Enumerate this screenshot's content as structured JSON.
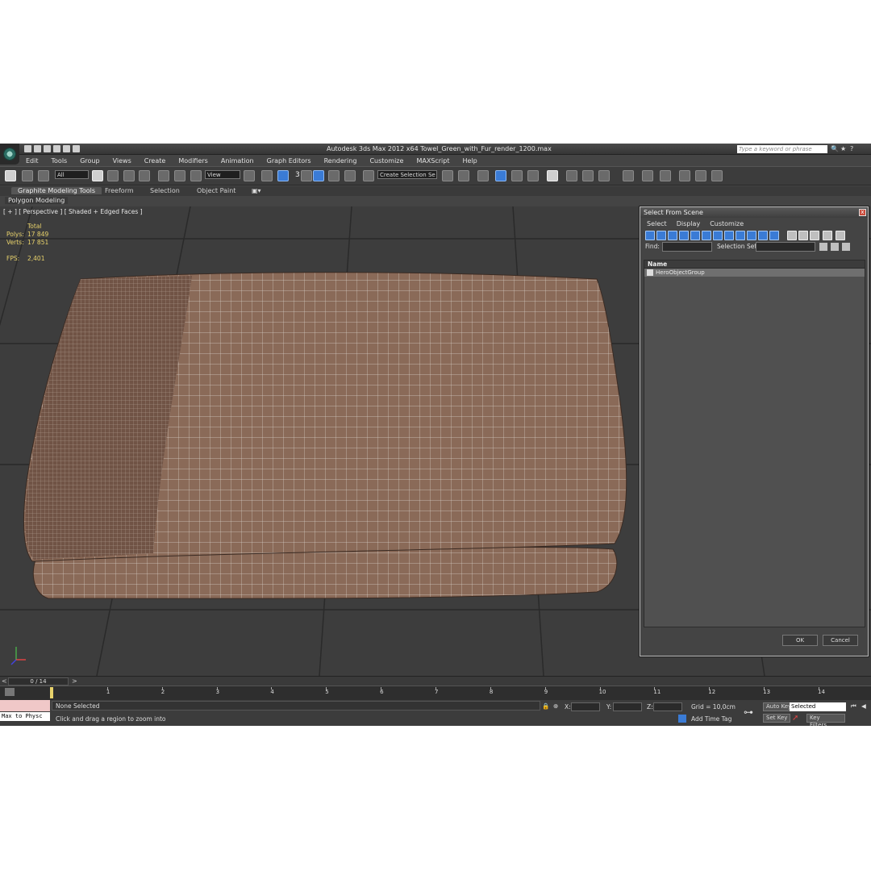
{
  "app": {
    "title": "Autodesk 3ds Max  2012 x64    Towel_Green_with_Fur_render_1200.max",
    "search_placeholder": "Type a keyword or phrase"
  },
  "menu": [
    "Edit",
    "Tools",
    "Group",
    "Views",
    "Create",
    "Modifiers",
    "Animation",
    "Graph Editors",
    "Rendering",
    "Customize",
    "MAXScript",
    "Help"
  ],
  "toolbar": {
    "filter_value": "All",
    "coord_value": "View",
    "selection_set_value": "Create Selection Se",
    "snap_label": "3"
  },
  "ribbon": {
    "tabs": [
      "Graphite Modeling Tools",
      "Freeform",
      "Selection",
      "Object Paint"
    ],
    "sub_tab": "Polygon Modeling"
  },
  "viewport": {
    "label": "[ + ] [ Perspective ] [ Shaded + Edged Faces ]",
    "stats": {
      "total_label": "Total",
      "polys_label": "Polys:",
      "polys_value": "17 849",
      "verts_label": "Verts:",
      "verts_value": "17 851",
      "fps_label": "FPS:",
      "fps_value": "2,401"
    }
  },
  "dialog": {
    "title": "Select From Scene",
    "close": "x",
    "menu": [
      "Select",
      "Display",
      "Customize"
    ],
    "find_label": "Find:",
    "selection_set_label": "Selection Set:",
    "column_name": "Name",
    "items": [
      "HeroObjectGroup"
    ],
    "ok_label": "OK",
    "cancel_label": "Cancel"
  },
  "timeline": {
    "slider_label": "0 / 14",
    "ticks": [
      "1",
      "2",
      "3",
      "4",
      "5",
      "6",
      "7",
      "8",
      "9",
      "10",
      "11",
      "12",
      "13",
      "14"
    ],
    "current_frame": 0,
    "total_frames": 14
  },
  "status": {
    "maxscript_text": "Max to Physc",
    "selection_text": "None Selected",
    "prompt_text": "Click and drag a region to zoom into",
    "x_label": "X:",
    "y_label": "Y:",
    "z_label": "Z:",
    "grid_text": "Grid = 10,0cm",
    "add_time_tag": "Add Time Tag",
    "auto_key": "Auto Key",
    "set_key": "Set Key",
    "key_mode_value": "Selected",
    "key_filters": "Key Filters..."
  },
  "colors": {
    "towel": "#8a6a58",
    "wire": "#d8cfc8",
    "accent_blue": "#3a7bd5",
    "stats_yellow": "#e8d26b"
  }
}
